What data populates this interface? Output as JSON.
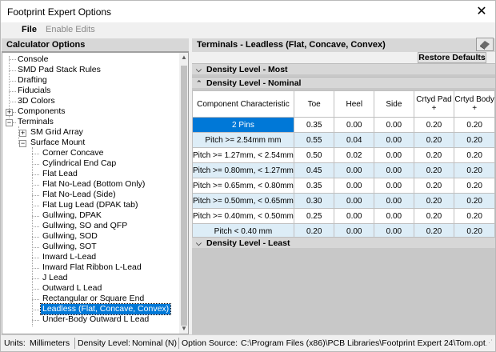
{
  "window": {
    "title": "Footprint Expert Options",
    "close_glyph": "✕"
  },
  "menu": {
    "file": "File",
    "enable_edits": "Enable Edits"
  },
  "left_panel": {
    "header": "Calculator Options",
    "tree": [
      {
        "label": "Console"
      },
      {
        "label": "SMD Pad Stack Rules"
      },
      {
        "label": "Drafting"
      },
      {
        "label": "Fiducials"
      },
      {
        "label": "3D Colors"
      },
      {
        "label": "Components"
      },
      {
        "label": "Terminals"
      },
      {
        "label": "SM Grid Array"
      },
      {
        "label": "Surface Mount"
      },
      {
        "label": "Corner Concave"
      },
      {
        "label": "Cylindrical End Cap"
      },
      {
        "label": "Flat Lead"
      },
      {
        "label": "Flat No-Lead (Bottom Only)"
      },
      {
        "label": "Flat No-Lead (Side)"
      },
      {
        "label": "Flat Lug Lead (DPAK tab)"
      },
      {
        "label": "Gullwing, DPAK"
      },
      {
        "label": "Gullwing, SO and QFP"
      },
      {
        "label": "Gullwing, SOD"
      },
      {
        "label": "Gullwing, SOT"
      },
      {
        "label": "Inward L-Lead"
      },
      {
        "label": "Inward Flat Ribbon L-Lead"
      },
      {
        "label": "J Lead"
      },
      {
        "label": "Outward L Lead"
      },
      {
        "label": "Rectangular or Square End"
      },
      {
        "label": "Leadless (Flat, Concave, Convex)"
      },
      {
        "label": "Under-Body Outward L Lead"
      }
    ]
  },
  "right_panel": {
    "header": "Terminals - Leadless (Flat, Concave, Convex)",
    "restore_defaults": "Restore Defaults",
    "sections": {
      "most": "Density Level - Most",
      "nominal": "Density Level - Nominal",
      "least": "Density Level - Least"
    },
    "table": {
      "headers": [
        "Component Characteristic",
        "Toe",
        "Heel",
        "Side",
        "Crtyd Pad +",
        "Crtyd Body +"
      ],
      "rows": [
        [
          "2 Pins",
          "0.35",
          "0.00",
          "0.00",
          "0.20",
          "0.20"
        ],
        [
          "Pitch >= 2.54mm mm",
          "0.55",
          "0.04",
          "0.00",
          "0.20",
          "0.20"
        ],
        [
          "Pitch >= 1.27mm, < 2.54mm",
          "0.50",
          "0.02",
          "0.00",
          "0.20",
          "0.20"
        ],
        [
          "Pitch >= 0.80mm, < 1.27mm",
          "0.45",
          "0.00",
          "0.00",
          "0.20",
          "0.20"
        ],
        [
          "Pitch >= 0.65mm, < 0.80mm",
          "0.35",
          "0.00",
          "0.00",
          "0.20",
          "0.20"
        ],
        [
          "Pitch >= 0.50mm, < 0.65mm",
          "0.30",
          "0.00",
          "0.00",
          "0.20",
          "0.20"
        ],
        [
          "Pitch >= 0.40mm, < 0.50mm",
          "0.25",
          "0.00",
          "0.00",
          "0.20",
          "0.20"
        ],
        [
          "Pitch < 0.40 mm",
          "0.20",
          "0.00",
          "0.00",
          "0.20",
          "0.20"
        ]
      ]
    }
  },
  "status": {
    "units_label": "Units:",
    "units_value": "Millimeters",
    "density_label": "Density Level:",
    "density_value": "Nominal (N)",
    "option_label": "Option Source:",
    "option_value": "C:\\Program Files (x86)\\PCB Libraries\\Footprint Expert 24\\Tom.opt"
  },
  "colors": {
    "selection": "#0078d7",
    "alt_row": "#ddedf7",
    "header_bg": "#d7d7d7"
  }
}
